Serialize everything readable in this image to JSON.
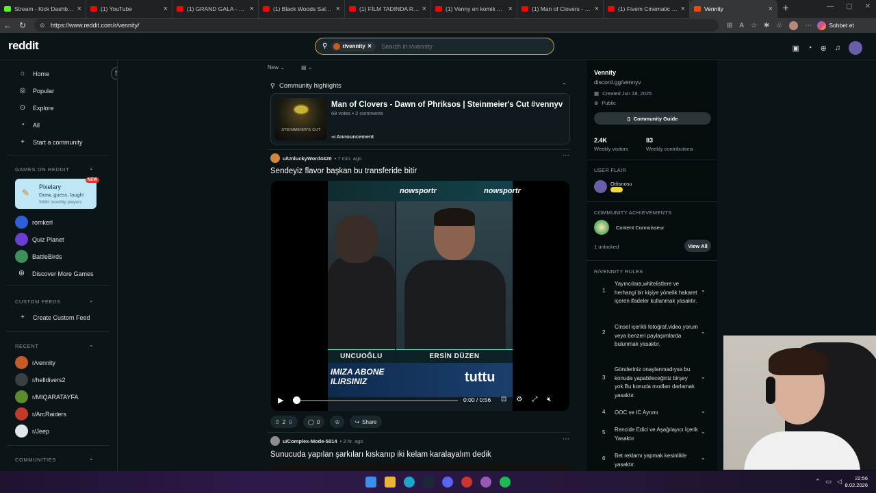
{
  "browser": {
    "tabs": [
      {
        "title": "Stream - Kick Dashboard",
        "color": "#53fc18"
      },
      {
        "title": "(1) YouTube",
        "color": "#ff0000"
      },
      {
        "title": "(1) GRAND GALA - GENİŞ Ö",
        "color": "#ff0000"
      },
      {
        "title": "(1) Black Woods Saloon- - F",
        "color": "#ff0000"
      },
      {
        "title": "(1) FİLM TADINDA ROL PAS",
        "color": "#ff0000"
      },
      {
        "title": "(1) Venny en komik ATM k",
        "color": "#ff0000"
      },
      {
        "title": "(1) Man of Clovers - Dawn",
        "color": "#ff0000"
      },
      {
        "title": "(1) Fivem Cinematic Clip - C",
        "color": "#ff0000"
      },
      {
        "title": "Vennity",
        "color": "#ff4500"
      }
    ],
    "url": "https://www.reddit.com/r/vennity/",
    "sohbet": "Sohbet et"
  },
  "header": {
    "logo": "reddit",
    "search_chip": "r/vennity",
    "search_placeholder": "Search in r/vennity"
  },
  "leftnav": {
    "items": [
      {
        "label": "Home",
        "icon": "⌂"
      },
      {
        "label": "Popular",
        "icon": "◎"
      },
      {
        "label": "Explore",
        "icon": "⊙"
      },
      {
        "label": "All",
        "icon": "◔"
      },
      {
        "label": "Start a community",
        "icon": "+"
      }
    ],
    "games_title": "GAMES ON REDDIT",
    "pixelary": {
      "name": "Pixelary",
      "desc": "Draw, guess, laugh!",
      "players": "548K monthly players",
      "badge": "NEW"
    },
    "games": [
      {
        "label": "romkerl",
        "color": "#2d5fd6"
      },
      {
        "label": "Quiz Planet",
        "color": "#6a3fd1"
      },
      {
        "label": "BattleBirds",
        "color": "#3f8f5a"
      },
      {
        "label": "Discover More Games",
        "color": "#0b1416"
      }
    ],
    "custom_title": "CUSTOM FEEDS",
    "custom_create": "Create Custom Feed",
    "recent_title": "RECENT",
    "recent": [
      {
        "label": "r/vennity",
        "color": "#c45b2b"
      },
      {
        "label": "r/helldivers2",
        "color": "#3a3f44"
      },
      {
        "label": "r/MIQARATAYFA",
        "color": "#5c8a2f"
      },
      {
        "label": "r/ArcRaiders",
        "color": "#c23a2a"
      },
      {
        "label": "r/Jeep",
        "color": "#e3e6e8"
      }
    ],
    "communities_title": "COMMUNITIES"
  },
  "feed": {
    "sort": "New",
    "view": "▤",
    "highlights_title": "Community highlights",
    "highlight": {
      "title": "Man of Clovers - Dawn of Phriksos | Steinmeier's Cut #vennyv",
      "meta": "69 votes • 2 comments",
      "tag": "Announcement",
      "thumb_caption": "STEINMEIER'S CUT"
    },
    "post1": {
      "user": "u/UnluckyWord4420",
      "time": "• 7 min. ago",
      "title": "Sendeyiz flavor başkan bu transferide bitir",
      "video": {
        "brand": "nowsportr",
        "name_left": "UNCUOĞLU",
        "name_right": "ERSİN DÜZEN",
        "banner_left_1": "IMIZA ABONE",
        "banner_left_2": "ILIRSINIZ",
        "banner_right": "tuttu",
        "time": "0:00 / 0:56",
        "progress": 0
      },
      "votes": "2",
      "comments": "0",
      "share": "Share"
    },
    "post2": {
      "user": "u/Complex-Mode-5014",
      "time": "• 3 hr. ago",
      "title": "Sunucuda yapılan şarkıları kıskanıp iki kelam karalayalım dedik"
    }
  },
  "sidebar": {
    "name": "Vennity",
    "desc": "discord.gg/vennyv",
    "created": "Created Jun 18, 2025",
    "visibility": "Public",
    "guide": "Community Guide",
    "visitors_value": "2.4K",
    "visitors_label": "Weekly visitors",
    "contrib_value": "83",
    "contrib_label": "Weekly contributions",
    "flair_title": "USER FLAIR",
    "flair_name": "Odisnosu",
    "ach_title": "COMMUNITY ACHIEVEMENTS",
    "ach_name": "Content Connoisseur",
    "unlocked": "1 unlocked",
    "view_all": "View All",
    "rules_title": "R/VENNITY RULES",
    "rules": [
      {
        "n": "1",
        "text": "Yayıncılara,whitelistlere ve herhangi bir kişiye yönelik hakaret içeren ifadeler kullanmak yasaktır."
      },
      {
        "n": "2",
        "text": "Cinsel içerikli fotoğraf,video,yorum veya benzeri paylaşımlarda bulunmak yasaktır."
      },
      {
        "n": "3",
        "text": "Gönderiniz onaylanmadıysa bu konuda yapabileceğiniz birşey yok.Bu konuda modları darlamak yasaktır."
      },
      {
        "n": "4",
        "text": "OOC ve IC Ayrımı"
      },
      {
        "n": "5",
        "text": "Rencide Edici ve Aşağılayıcı İçerik Yasaktır"
      },
      {
        "n": "6",
        "text": "Bet reklamı yapmak kesinlikle yasaktır."
      }
    ]
  },
  "taskbar": {
    "time": "22:56",
    "date": "8.02.2026"
  }
}
